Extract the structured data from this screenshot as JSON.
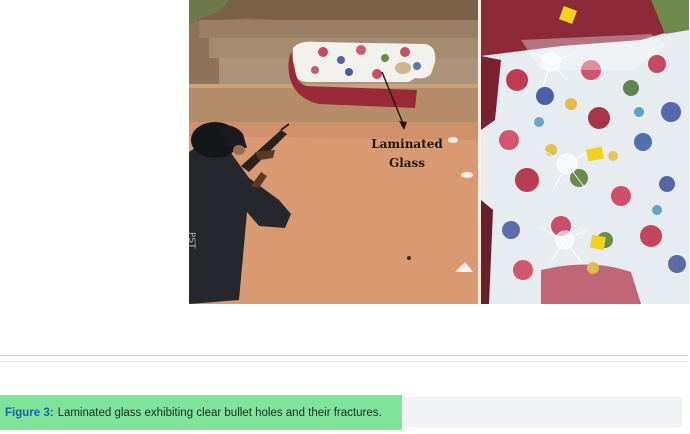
{
  "figure": {
    "annotation": "Laminated\nGlass"
  },
  "caption": {
    "label": "Figure 3:",
    "text": "Laminated glass exhibiting clear bullet holes and their fractures."
  },
  "colors": {
    "caption_highlight": "#7fe39a",
    "caption_label": "#1f5fa8"
  }
}
